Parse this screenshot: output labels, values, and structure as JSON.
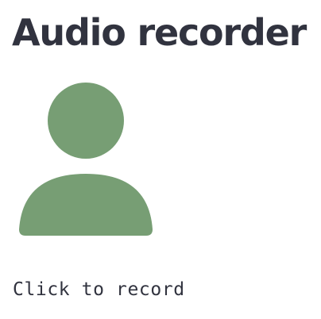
{
  "title": "Audio recorder",
  "recorder": {
    "icon": "user-icon",
    "icon_color": "#779e74",
    "hint": "Click to record"
  },
  "colors": {
    "text": "#31333f",
    "background": "#ffffff"
  }
}
